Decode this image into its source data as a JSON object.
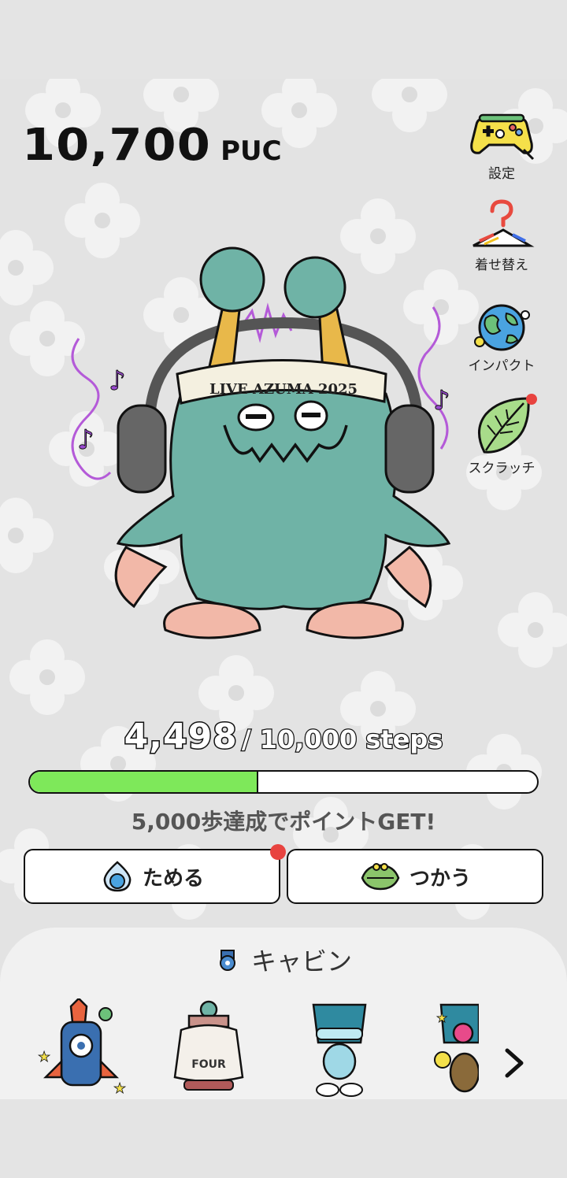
{
  "balance": {
    "amount": "10,700",
    "unit": "PUC"
  },
  "side_menu": [
    {
      "label": "設定",
      "icon": "game-controller-icon"
    },
    {
      "label": "着せ替え",
      "icon": "hanger-question-icon"
    },
    {
      "label": "インパクト",
      "icon": "earth-icon"
    },
    {
      "label": "スクラッチ",
      "icon": "leaf-icon",
      "badge": true
    }
  ],
  "character": {
    "headband_text": "LIVE AZUMA 2025"
  },
  "steps": {
    "current": "4,498",
    "goal": "/ 10,000 steps",
    "progress": 0.4498
  },
  "goal_message": "5,000歩達成でポイントGET!",
  "actions": {
    "save_label": "ためる",
    "use_label": "つかう"
  },
  "cabin": {
    "title": "キャビン",
    "items": [
      "rocket-cabin-icon",
      "sweater-monster-cabin-icon",
      "bucket-robot-cabin-icon",
      "flower-robot-cabin-icon"
    ]
  },
  "colors": {
    "progress": "#7ee85a",
    "badge": "#e8433f",
    "monster": "#6fb3a6"
  }
}
